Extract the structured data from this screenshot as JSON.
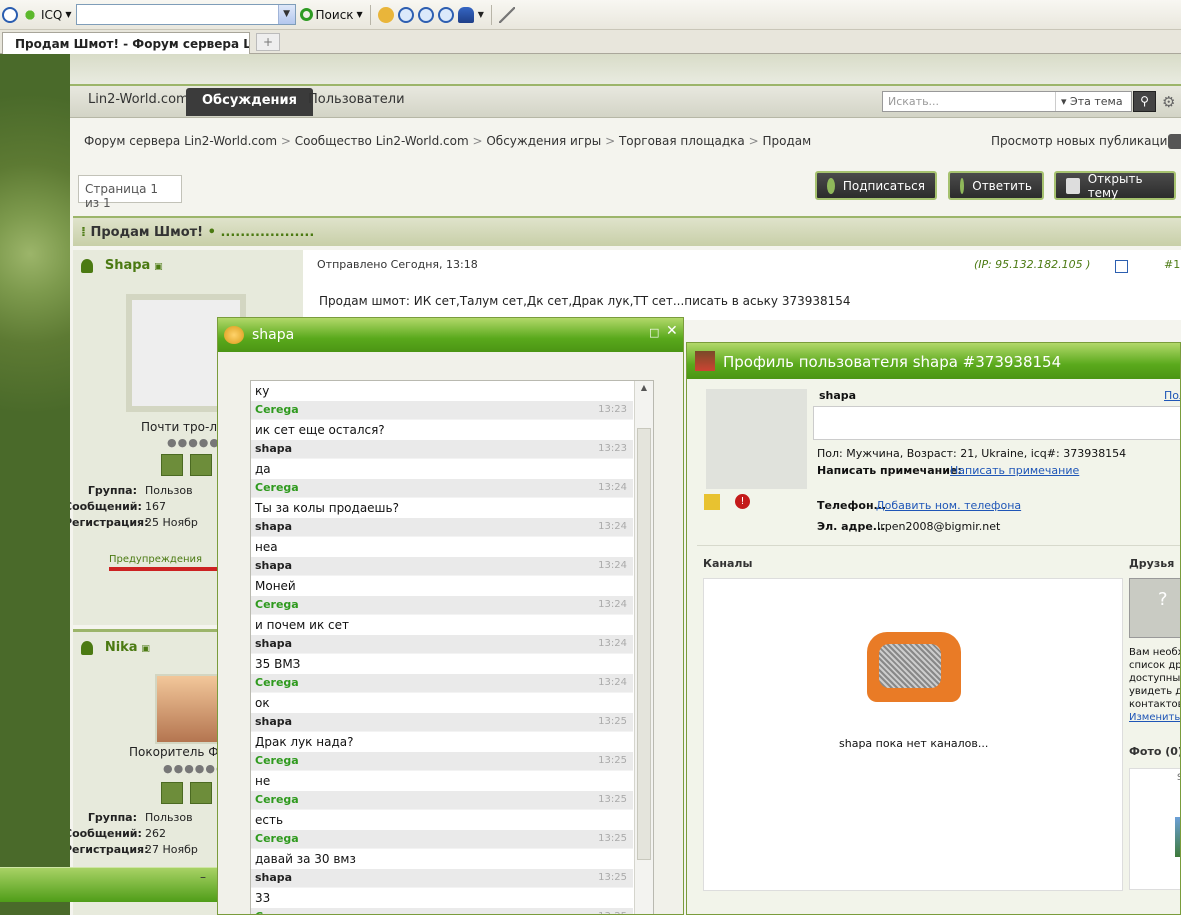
{
  "toolbar": {
    "icq_label": "ICQ",
    "search_label": "Поиск"
  },
  "tab": {
    "title": "Продам Шмот! - Форум сервера Lin...",
    "add": "+"
  },
  "nav": {
    "items": [
      "Lin2-World.com",
      "Обсуждения",
      "Пользователи"
    ],
    "active": "Обсуждения",
    "search_placeholder": "Искать...",
    "search_scope": "Эта тема"
  },
  "breadcrumb": [
    "Форум сервера Lin2-World.com",
    "Сообщество Lin2-World.com",
    "Обсуждения игры",
    "Торговая площадка",
    "Продам"
  ],
  "new_publications": "Просмотр новых публикаций",
  "pager": "Страница 1 из 1",
  "buttons": {
    "subscribe": "Подписаться",
    "reply": "Ответить",
    "new_topic": "Открыть тему"
  },
  "topic": {
    "title": "Продам Шмот!",
    "dots": "• ..................."
  },
  "post1": {
    "author": "Shapa",
    "rank": "Почти тро-ло-",
    "sent": "Отправлено Сегодня, 13:18",
    "ip": "(IP: 95.132.182.105 )",
    "num": "#1",
    "text": "Продам шмот: ИК сет,Талум сет,Дк сет,Драк лук,ТТ сет...писать в аську 373938154",
    "group_label": "Группа:",
    "group": "Пользов",
    "posts_label": "Сообщений:",
    "posts": "167",
    "reg_label": "Регистрация:",
    "reg": "25 Ноябр",
    "warnings": "Предупреждения"
  },
  "post2": {
    "author": "Nika",
    "rank": "Покоритель Фо",
    "group_label": "Группа:",
    "group": "Пользов",
    "posts_label": "Сообщений:",
    "posts": "262",
    "reg_label": "Регистрация:",
    "reg": "27 Ноябр"
  },
  "chat": {
    "title": "shapa",
    "messages": [
      {
        "text": "ку",
        "who": "Cerega",
        "time": "13:23"
      },
      {
        "text": "ик сет еще остался?",
        "who": "shapa",
        "time": "13:23"
      },
      {
        "text": "да",
        "who": "Cerega",
        "time": "13:24"
      },
      {
        "text": "Ты за колы продаешь?",
        "who": "shapa",
        "time": "13:24"
      },
      {
        "text": "неа",
        "who": "shapa",
        "time": "13:24"
      },
      {
        "text": "Моней",
        "who": "Cerega",
        "time": "13:24"
      },
      {
        "text": "и почем ик сет",
        "who": "shapa",
        "time": "13:24"
      },
      {
        "text": "35 ВМЗ",
        "who": "Cerega",
        "time": "13:24"
      },
      {
        "text": "ок",
        "who": "shapa",
        "time": "13:25"
      },
      {
        "text": "Драк лук нада?",
        "who": "Cerega",
        "time": "13:25"
      },
      {
        "text": "не",
        "who": "Cerega",
        "time": "13:25"
      },
      {
        "text": "есть",
        "who": "Cerega",
        "time": "13:25"
      },
      {
        "text": "давай за 30 вмз",
        "who": "shapa",
        "time": "13:25"
      },
      {
        "text": "33",
        "who": "Cerega",
        "time": "13:25"
      }
    ]
  },
  "profile": {
    "title": "Профиль пользователя shapa #373938154",
    "name": "shapa",
    "link_top": "Пол",
    "info": "Пол: Мужчина, Возраст: 21, Ukraine, icq#: 373938154",
    "note_label": "Написать примечание:",
    "note_link": "Написать примечание",
    "phone_label": "Телефон...",
    "phone_link": "Добавить ном. телефона",
    "email_label": "Эл. адре...",
    "email": "Irpen2008@bigmir.net",
    "channels_label": "Каналы",
    "no_channels": "shapa пока нет каналов...",
    "friends_label": "Друзья",
    "friends_text": [
      "Вам необхо",
      "список дру",
      "доступным",
      "увидеть д",
      "контактов"
    ],
    "friends_link": "Изменить н",
    "photos_label": "Фото (0)",
    "photo_letter": "S"
  }
}
